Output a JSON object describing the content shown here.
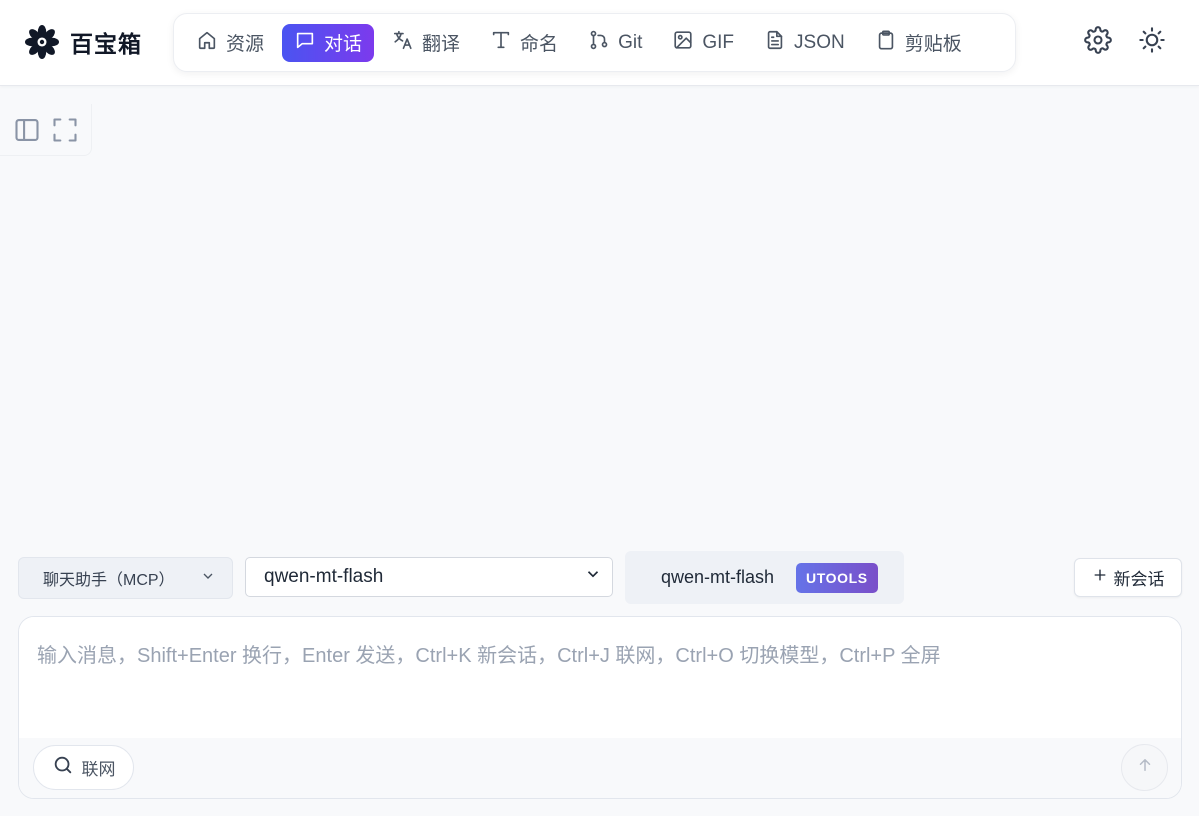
{
  "app": {
    "name": "百宝箱",
    "logo_icon": "flower-logo-icon"
  },
  "nav": {
    "items": [
      {
        "label": "资源",
        "icon": "home-icon"
      },
      {
        "label": "对话",
        "icon": "chat-icon",
        "active": true
      },
      {
        "label": "翻译",
        "icon": "translate-icon"
      },
      {
        "label": "命名",
        "icon": "text-icon"
      },
      {
        "label": "Git",
        "icon": "git-branch-icon"
      },
      {
        "label": "GIF",
        "icon": "image-icon"
      },
      {
        "label": "JSON",
        "icon": "file-text-icon"
      },
      {
        "label": "剪贴板",
        "icon": "clipboard-icon"
      }
    ]
  },
  "header_actions": {
    "settings_icon": "gear-icon",
    "theme_icon": "sun-icon"
  },
  "toolbar": {
    "sidebar_toggle_icon": "sidebar-toggle-icon",
    "fullscreen_icon": "fullscreen-icon"
  },
  "controls": {
    "assistant_select": "聊天助手（MCP）",
    "model_select": "qwen-mt-flash",
    "model_tag_name": "qwen-mt-flash",
    "model_tag_badge": "UTOOLS",
    "new_chat_label": "新会话"
  },
  "input": {
    "placeholder": "输入消息，Shift+Enter 换行，Enter 发送，Ctrl+K 新会话，Ctrl+J 联网，Ctrl+O 切换模型，Ctrl+P 全屏",
    "value": "",
    "web_search_label": "联网"
  },
  "colors": {
    "accent_start": "#4a54f1",
    "accent_end": "#7c3aed",
    "background": "#f8f9fb"
  }
}
